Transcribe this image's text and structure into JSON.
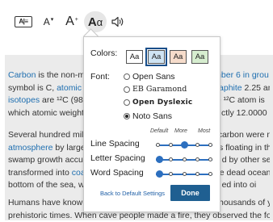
{
  "toolbar": {
    "reader_label": "A|≡",
    "decrease_label": "A",
    "increase_label": "A",
    "text_settings_label": "A",
    "text_settings_small": "α",
    "minus_caret": "▾",
    "plus_caret": "+"
  },
  "article": {
    "p1": [
      {
        "pre": "",
        "link": "Carbon",
        "mid": " is the non-m",
        "link2": "",
        "tail": "mber 6 in grou"
      },
      {
        "pre": "symbol is C, ",
        "link": "atomic w",
        "mid": "",
        "link2": "raphite",
        "tail": " 2.25 an"
      },
      {
        "pre": "",
        "link": "isotopes",
        "mid": " are ¹²C (98.",
        "link2": "",
        "tail": "e ¹²C atom is"
      },
      {
        "pre": "which atomic weight",
        "link": "",
        "mid": "",
        "link2": "",
        "tail": "ctly 12.0000"
      }
    ],
    "p2": [
      {
        "pre": "Several hundred mill",
        "link": "",
        "mid": "",
        "link2": "",
        "tail": "carbon were nen"
      },
      {
        "pre": "",
        "link": "atmosphere",
        "mid": " by large",
        "link2": "",
        "tail": "ss floating in the"
      },
      {
        "pre": "swamp growth accu",
        "link": "",
        "mid": "",
        "link2": "",
        "tail": "d by other sedi"
      },
      {
        "pre": "transformed into ",
        "link": "coa",
        "mid": "",
        "link2": "",
        "tail": "e dead ocean o"
      },
      {
        "pre": "bottom of the sea, w",
        "link": "",
        "mid": "",
        "link2": "",
        "tail": "ed into oi"
      }
    ],
    "p3": [
      {
        "pre": "Humans have known",
        "tail": "thousands of yea"
      },
      {
        "pre": "prehistoric times. When cave people made a fire, they observed the form",
        "tail": ""
      }
    ]
  },
  "popup": {
    "colors_label": "Colors:",
    "color_options": [
      {
        "text": "Aa",
        "bg": "#ffffff",
        "fg": "#222222"
      },
      {
        "text": "Aa",
        "bg": "#cfe4f3",
        "fg": "#222222"
      },
      {
        "text": "Aa",
        "bg": "#f6dccb",
        "fg": "#222222"
      },
      {
        "text": "Aa",
        "bg": "#d6edcf",
        "fg": "#222222"
      }
    ],
    "selected_color_index": 1,
    "font_label": "Font:",
    "font_options": [
      "Open Sans",
      "EB Garamond",
      "Open Dyslexic",
      "Noto Sans"
    ],
    "selected_font": "Noto Sans",
    "col_default": "Default",
    "col_more": "More",
    "col_most": "Most",
    "line_spacing_label": "Line Spacing",
    "letter_spacing_label": "Letter Spacing",
    "word_spacing_label": "Word Spacing",
    "line_spacing_level": 0.5,
    "letter_spacing_level": 0,
    "word_spacing_level": 0,
    "back_default_label": "Back to Default Settings",
    "done_label": "Done",
    "accent_color": "#2c6fbf",
    "done_color": "#1f5f91"
  }
}
